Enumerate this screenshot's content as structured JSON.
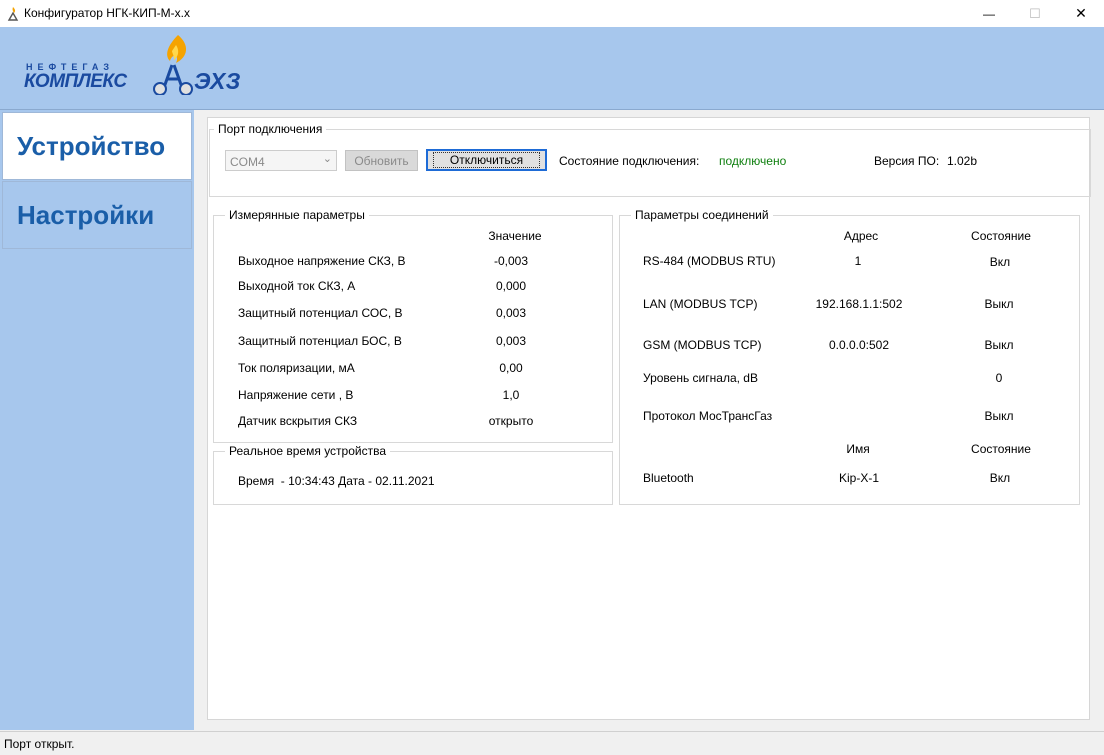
{
  "window": {
    "title": "Конфигуратор НГК-КИП-М-x.x",
    "minimize": "—",
    "maximize": "☐",
    "close": "✕"
  },
  "logo": {
    "top_word": "НЕФТЕГАЗ",
    "main_word": "КОМПЛЕКС",
    "suffix": "ЭХЗ"
  },
  "sidebar": {
    "items": [
      {
        "label": "Устройство"
      },
      {
        "label": "Настройки"
      }
    ]
  },
  "port": {
    "group_title": "Порт подключения",
    "selected_port": "COM4",
    "refresh_label": "Обновить",
    "disconnect_label": "Отключиться",
    "state_label": "Состояние подключения:",
    "state_value": "подключено",
    "state_color": "#108010",
    "version_label": "Версия ПО:",
    "version_value": "1.02b"
  },
  "measured": {
    "group_title": "Измерянные параметры",
    "value_header": "Значение",
    "rows": [
      {
        "label": "Выходное напряжение СКЗ, В",
        "value": "-0,003"
      },
      {
        "label": "Выходной ток СКЗ, А",
        "value": "0,000"
      },
      {
        "label": "Защитный потенциал СОС, В",
        "value": "0,003"
      },
      {
        "label": "Защитный потенциал БОС, В",
        "value": "0,003"
      },
      {
        "label": "Ток поляризации, мА",
        "value": "0,00"
      },
      {
        "label": "Напряжение сети , В",
        "value": "1,0"
      },
      {
        "label": "Датчик вскрытия СКЗ",
        "value": "открыто"
      }
    ]
  },
  "realtime": {
    "group_title": "Реальное время устройства",
    "text": "Время  - 10:34:43 Дата - 02.11.2021"
  },
  "connections": {
    "group_title": "Параметры соединений",
    "address_header": "Адрес",
    "state_header": "Состояние",
    "rows": [
      {
        "label": "RS-484 (MODBUS RTU)",
        "address": "1",
        "state": "Вкл"
      },
      {
        "label": "LAN (MODBUS TCP)",
        "address": "192.168.1.1:502",
        "state": "Выкл"
      },
      {
        "label": "GSM (MODBUS TCP)",
        "address": "0.0.0.0:502",
        "state": "Выкл"
      },
      {
        "label": "Уровень сигнала, dB",
        "address": "",
        "state": "0"
      },
      {
        "label": "Протокол МосТрансГаз",
        "address": "",
        "state": "Выкл"
      }
    ],
    "name_header": "Имя",
    "state_header2": "Состояние",
    "bluetooth": {
      "label": "Bluetooth",
      "name": "Kip-X-1",
      "state": "Вкл"
    }
  },
  "statusbar": {
    "text": "Порт открыт."
  }
}
